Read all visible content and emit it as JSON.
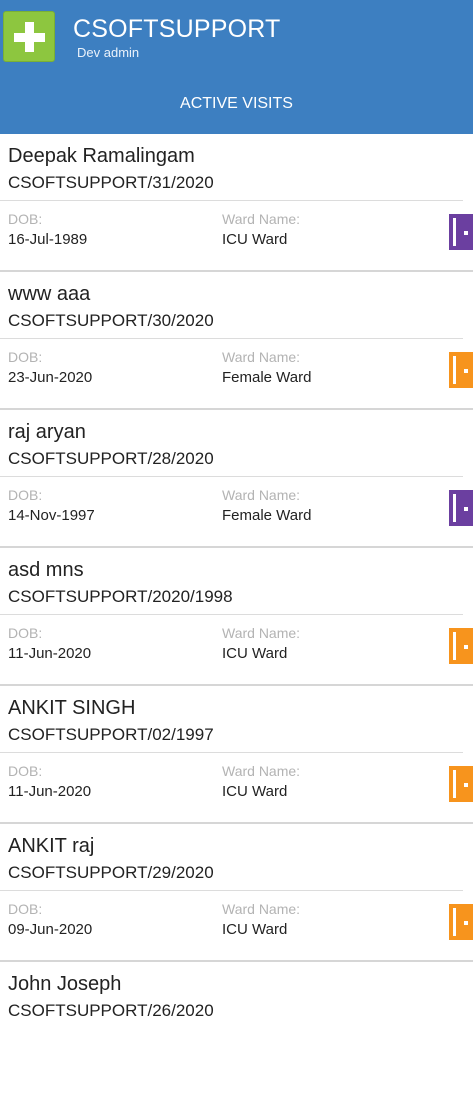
{
  "app": {
    "title": "CSOFTSUPPORT",
    "subtitle": "Dev admin"
  },
  "tab": {
    "label": "ACTIVE VISITS"
  },
  "labels": {
    "dob": "DOB:",
    "ward": "Ward Name:"
  },
  "colors": {
    "header": "#3d7fc1",
    "logo": "#8dc63f",
    "door_purple": "#6b3fa0",
    "door_orange": "#f7941d"
  },
  "visits": [
    {
      "name": "Deepak Ramalingam",
      "code": "CSOFTSUPPORT/31/2020",
      "dob": "16-Jul-1989",
      "ward": "ICU Ward",
      "icon": "door-purple-icon"
    },
    {
      "name": "www aaa",
      "code": "CSOFTSUPPORT/30/2020",
      "dob": "23-Jun-2020",
      "ward": "Female Ward",
      "icon": "door-orange-icon"
    },
    {
      "name": "raj aryan",
      "code": "CSOFTSUPPORT/28/2020",
      "dob": "14-Nov-1997",
      "ward": "Female Ward",
      "icon": "door-purple-icon"
    },
    {
      "name": "asd mns",
      "code": "CSOFTSUPPORT/2020/1998",
      "dob": "11-Jun-2020",
      "ward": "ICU Ward",
      "icon": "door-orange-icon"
    },
    {
      "name": "ANKIT SINGH",
      "code": "CSOFTSUPPORT/02/1997",
      "dob": "11-Jun-2020",
      "ward": "ICU Ward",
      "icon": "door-orange-icon"
    },
    {
      "name": "ANKIT raj",
      "code": "CSOFTSUPPORT/29/2020",
      "dob": "09-Jun-2020",
      "ward": "ICU Ward",
      "icon": "door-orange-icon"
    },
    {
      "name": "John Joseph",
      "code": "CSOFTSUPPORT/26/2020"
    }
  ]
}
